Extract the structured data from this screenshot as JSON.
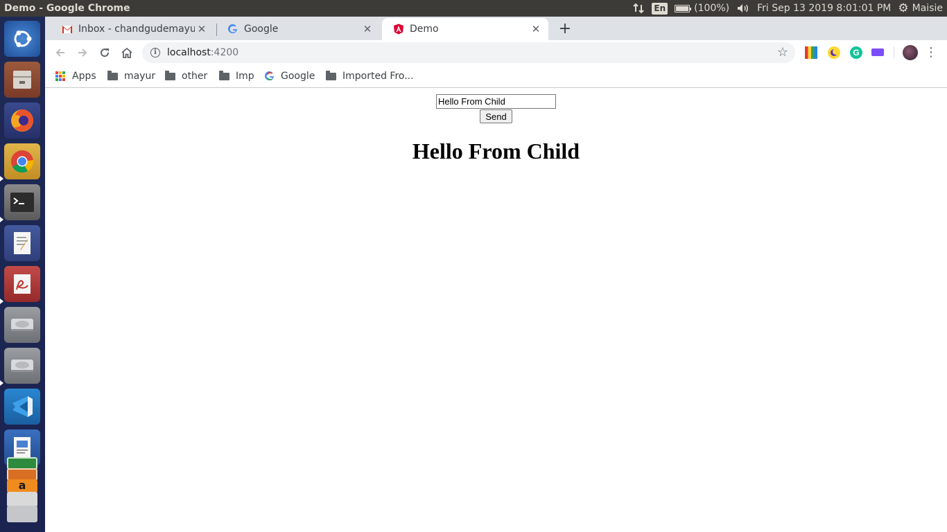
{
  "window": {
    "title": "Demo - Google Chrome"
  },
  "top_panel": {
    "language": "En",
    "battery": "(100%)",
    "battery_level": 1.0,
    "datetime": "Fri Sep 13 2019  8:01:01 PM",
    "user": "Maisie"
  },
  "launcher": {
    "items": [
      {
        "name": "ubuntu-dash-icon",
        "color": "#2f6db4"
      },
      {
        "name": "files-icon",
        "color": "#8e4a35"
      },
      {
        "name": "firefox-icon",
        "color": "#f0731f"
      },
      {
        "name": "chrome-icon",
        "color": "#d9a63c"
      },
      {
        "name": "terminal-icon",
        "color": "#5a5a5a"
      },
      {
        "name": "text-editor-icon",
        "color": "#3b4b8a"
      },
      {
        "name": "pdf-viewer-icon",
        "color": "#b0373a"
      },
      {
        "name": "drive-icon",
        "color": "#8a8d91"
      },
      {
        "name": "drive-icon",
        "color": "#8a8d91"
      },
      {
        "name": "vscode-icon",
        "color": "#1e73b8"
      },
      {
        "name": "writer-icon",
        "color": "#2b5eac"
      }
    ]
  },
  "tabs": [
    {
      "title": "Inbox - chandgudemayur",
      "icon": "gmail-icon",
      "active": false
    },
    {
      "title": "Google",
      "icon": "google-icon",
      "active": false
    },
    {
      "title": "Demo",
      "icon": "angular-icon",
      "active": true
    }
  ],
  "address_bar": {
    "host": "localhost",
    "port": ":4200"
  },
  "bookmarks": [
    {
      "label": "Apps",
      "icon": "apps-grid-icon"
    },
    {
      "label": "mayur",
      "icon": "folder-icon"
    },
    {
      "label": "other",
      "icon": "folder-icon"
    },
    {
      "label": "Imp",
      "icon": "folder-icon"
    },
    {
      "label": "Google",
      "icon": "google-icon"
    },
    {
      "label": "Imported Fro...",
      "icon": "folder-icon"
    }
  ],
  "page": {
    "input_value": "Hello From Child",
    "send_label": "Send",
    "heading": "Hello From Child"
  },
  "colors": {
    "chrome_frame": "#dee1e6",
    "ubuntu_panel": "#3c3b37",
    "launcher": "#1e2a55",
    "angular_red": "#dd0031",
    "gmail_red": "#d93025"
  }
}
